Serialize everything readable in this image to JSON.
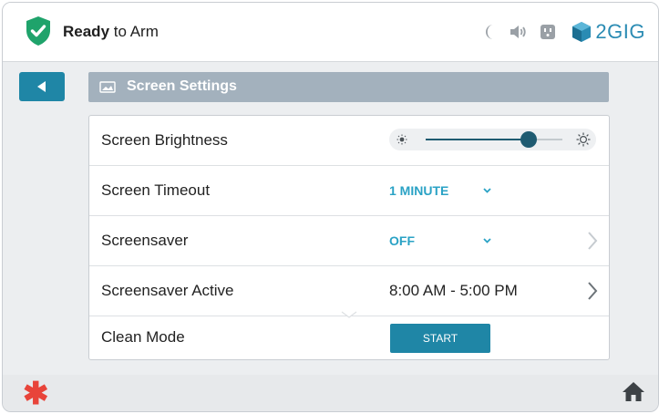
{
  "header": {
    "status_bold": "Ready",
    "status_rest": " to Arm",
    "brand": "2GIG",
    "icons": [
      "shield-check-icon",
      "moon-icon",
      "speaker-icon",
      "outlet-icon",
      "2gig-logo-icon"
    ]
  },
  "nav": {
    "back_icon": "back-arrow-icon",
    "title": "Screen Settings",
    "title_icon": "screen-icon"
  },
  "settings": {
    "brightness": {
      "label": "Screen Brightness",
      "level": 0.75
    },
    "timeout": {
      "label": "Screen Timeout",
      "value": "1 MINUTE"
    },
    "screensaver": {
      "label": "Screensaver",
      "value": "OFF"
    },
    "screensaver_active": {
      "label": "Screensaver Active",
      "value": "8:00 AM - 5:00 PM"
    },
    "clean_mode": {
      "label": "Clean Mode",
      "button": "START"
    }
  },
  "footer": {
    "icons": [
      "asterisk-icon",
      "home-icon"
    ]
  },
  "colors": {
    "accent": "#1f86a6",
    "value_blue": "#2aa2c5",
    "shield_green": "#1fa36b",
    "title_bar": "#a3b1bd",
    "asterisk_red": "#e8443a"
  }
}
